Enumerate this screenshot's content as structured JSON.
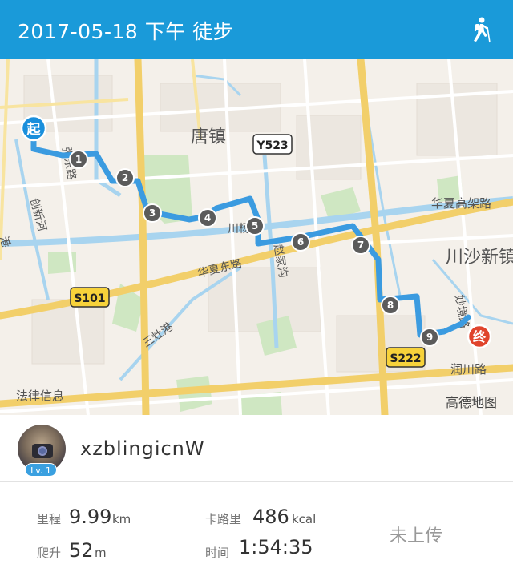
{
  "header": {
    "title": "2017-05-18 下午  徒步",
    "activity_icon": "hiker-icon",
    "background_color": "#1a9ad9"
  },
  "map": {
    "place_labels": {
      "tangzhen": "唐镇",
      "chuanshaxin": "川沙新镇",
      "falvxinxi": "法律信息",
      "sanzaogang": "三灶港",
      "chuanxinhe": "创新河",
      "huaxiadonglu": "华夏东路",
      "huaxiagaojialu": "华夏高架路",
      "runchuanlu": "润川路",
      "miaojinglu": "妙境路",
      "chuanyangh": "川杨河",
      "jiahaogou": "赵家沟",
      "zhanglu": "张东路",
      "gang": "港"
    },
    "road_badges": [
      "Y523",
      "S101",
      "S222"
    ],
    "start_marker": "起",
    "end_marker": "终",
    "km_markers": [
      "1",
      "2",
      "3",
      "4",
      "5",
      "6",
      "7",
      "8",
      "9"
    ],
    "attribution": "高德地图",
    "route_color": "#3b9be0",
    "start_color": "#1a8fdc",
    "end_color": "#e0442c"
  },
  "profile": {
    "username": "xzblingicnW",
    "level": "Lv. 1"
  },
  "stats": {
    "distance_label": "里程",
    "distance_value": "9.99",
    "distance_unit": "km",
    "climb_label": "爬升",
    "climb_value": "52",
    "climb_unit": "m",
    "calorie_label": "卡路里",
    "calorie_value": "486",
    "calorie_unit": "kcal",
    "time_label": "时间",
    "time_value": "1:54:35",
    "upload_status": "未上传"
  }
}
